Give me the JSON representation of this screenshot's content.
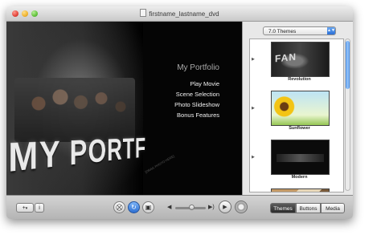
{
  "window": {
    "title": "firstname_lastname_dvd"
  },
  "preview": {
    "menu_title": "My Portfolio",
    "menu_items": [
      "Play Movie",
      "Scene Selection",
      "Photo Slideshow",
      "Bonus Features"
    ],
    "background_title": "MY PORTF",
    "watermark": "[DRAG PHOTO HERE]"
  },
  "panel": {
    "theme_set": "7.0 Themes",
    "themes": [
      {
        "name": "Revolution",
        "thumb_text": "FAN"
      },
      {
        "name": "Sunflower",
        "thumb_text": ""
      },
      {
        "name": "Modern",
        "thumb_text": ""
      },
      {
        "name": "",
        "thumb_text": ""
      }
    ]
  },
  "toolbar": {
    "add_label": "+",
    "info_label": "i",
    "segments": [
      "Themes",
      "Buttons",
      "Media"
    ],
    "selected_segment": "Themes",
    "volume_level": 0.55
  },
  "colors": {
    "accent": "#2d6fd2",
    "selected_segment": "#3a3a3a"
  }
}
